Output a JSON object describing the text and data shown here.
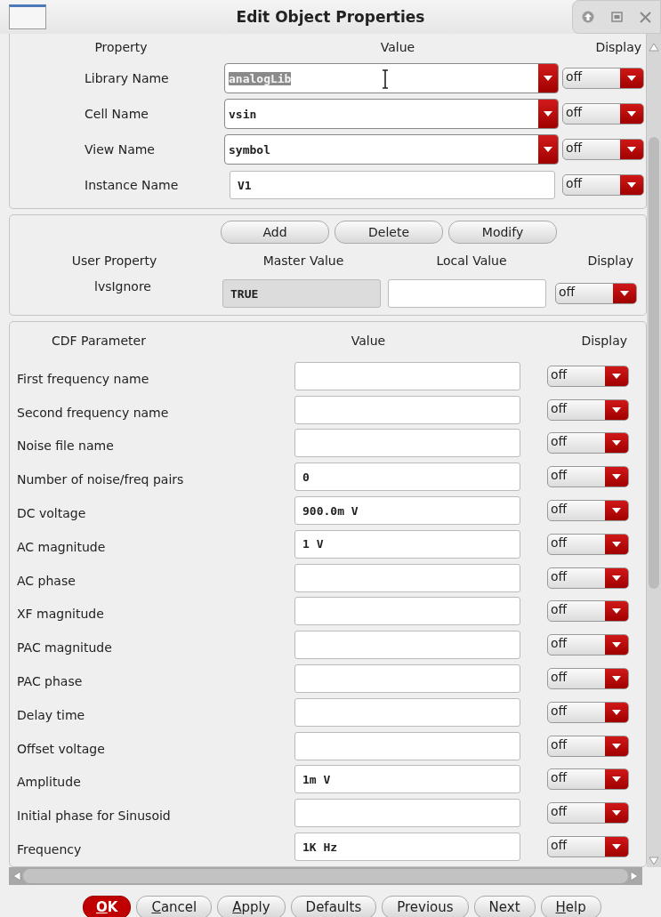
{
  "window": {
    "title": "Edit Object Properties"
  },
  "properties": {
    "columns": [
      "Property",
      "Value",
      "Display"
    ],
    "rows": [
      {
        "label": "Library Name",
        "value": "analogLib",
        "kind": "combo",
        "text_selected": true,
        "display": "off"
      },
      {
        "label": "Cell Name",
        "value": "vsin",
        "kind": "combo",
        "display": "off"
      },
      {
        "label": "View Name",
        "value": "symbol",
        "kind": "combo",
        "display": "off"
      },
      {
        "label": "Instance Name",
        "value": "V1",
        "kind": "text",
        "display": "off"
      }
    ]
  },
  "user_properties": {
    "buttons": [
      "Add",
      "Delete",
      "Modify"
    ],
    "columns": [
      "User Property",
      "Master Value",
      "Local Value",
      "Display"
    ],
    "rows": [
      {
        "name": "lvsIgnore",
        "master_value": "TRUE",
        "display": "off"
      }
    ]
  },
  "cdf": {
    "columns": [
      "CDF Parameter",
      "Value",
      "Display"
    ],
    "rows": [
      {
        "label": "First frequency name",
        "value": "",
        "display": "off"
      },
      {
        "label": "Second frequency name",
        "value": "",
        "display": "off"
      },
      {
        "label": "Noise file name",
        "value": "",
        "display": "off"
      },
      {
        "label": "Number of noise/freq pairs",
        "value": "0",
        "display": "off"
      },
      {
        "label": "DC voltage",
        "value": "900.0m V",
        "display": "off"
      },
      {
        "label": "AC magnitude",
        "value": "1 V",
        "display": "off"
      },
      {
        "label": "AC phase",
        "value": "",
        "display": "off"
      },
      {
        "label": "XF magnitude",
        "value": "",
        "display": "off"
      },
      {
        "label": "PAC magnitude",
        "value": "",
        "display": "off"
      },
      {
        "label": "PAC phase",
        "value": "",
        "display": "off"
      },
      {
        "label": "Delay time",
        "value": "",
        "display": "off"
      },
      {
        "label": "Offset voltage",
        "value": "",
        "display": "off"
      },
      {
        "label": "Amplitude",
        "value": "1m V",
        "display": "off"
      },
      {
        "label": "Initial phase for Sinusoid",
        "value": "",
        "display": "off"
      },
      {
        "label": "Frequency",
        "value": "1K Hz",
        "display": "off"
      }
    ]
  },
  "buttons": [
    {
      "label": "OK",
      "primary": true,
      "underline_first": true
    },
    {
      "label": "Cancel",
      "primary": false,
      "underline_first": true
    },
    {
      "label": "Apply",
      "primary": false,
      "underline_first": true
    },
    {
      "label": "Defaults",
      "primary": false,
      "underline_first": false
    },
    {
      "label": "Previous",
      "primary": false,
      "underline_first": false
    },
    {
      "label": "Next",
      "primary": false,
      "underline_first": false
    },
    {
      "label": "Help",
      "primary": false,
      "underline_first": true
    }
  ]
}
